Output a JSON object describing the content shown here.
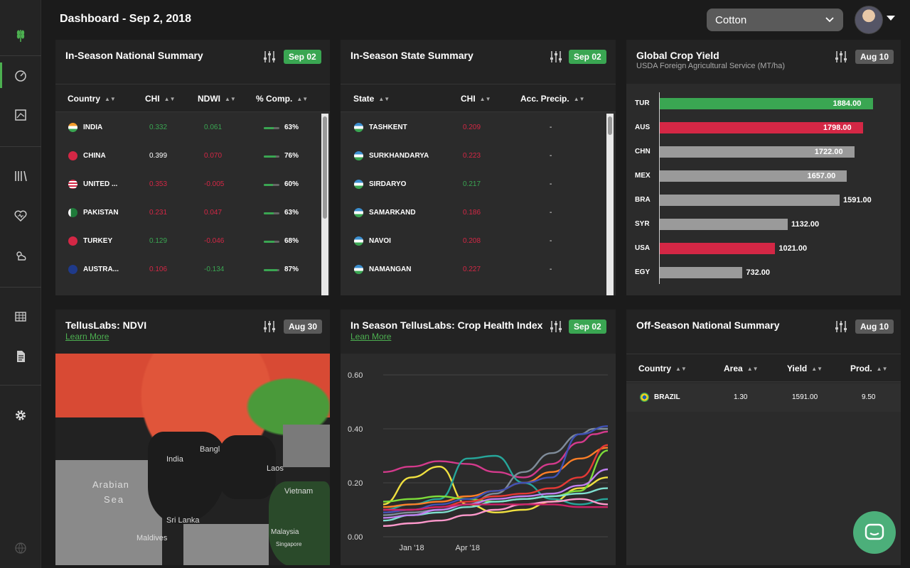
{
  "header": {
    "title": "Dashboard - Sep 2, 2018",
    "crop_selected": "Cotton"
  },
  "colors": {
    "accent": "#3aa652",
    "negative": "#d42745",
    "neutral": "#9a9a9a"
  },
  "panels": {
    "national": {
      "title": "In-Season National Summary",
      "badge": "Sep 02",
      "columns": [
        "Country",
        "CHI",
        "NDWI",
        "% Comp."
      ],
      "rows": [
        {
          "country": "INDIA",
          "chi": "0.332",
          "chi_sign": "pos",
          "ndwi": "0.061",
          "ndwi_sign": "pos",
          "comp": "63%",
          "comp_frac": 0.63
        },
        {
          "country": "CHINA",
          "chi": "0.399",
          "chi_sign": "neutral",
          "ndwi": "0.070",
          "ndwi_sign": "neg",
          "comp": "76%",
          "comp_frac": 0.76
        },
        {
          "country": "UNITED ...",
          "chi": "0.353",
          "chi_sign": "neg",
          "ndwi": "-0.005",
          "ndwi_sign": "neg",
          "comp": "60%",
          "comp_frac": 0.6
        },
        {
          "country": "PAKISTAN",
          "chi": "0.231",
          "chi_sign": "neg",
          "ndwi": "0.047",
          "ndwi_sign": "neg",
          "comp": "63%",
          "comp_frac": 0.63
        },
        {
          "country": "TURKEY",
          "chi": "0.129",
          "chi_sign": "pos",
          "ndwi": "-0.046",
          "ndwi_sign": "neg",
          "comp": "68%",
          "comp_frac": 0.68
        },
        {
          "country": "AUSTRA...",
          "chi": "0.106",
          "chi_sign": "neg",
          "ndwi": "-0.134",
          "ndwi_sign": "pos",
          "comp": "87%",
          "comp_frac": 0.87
        }
      ]
    },
    "state": {
      "title": "In-Season State Summary",
      "badge": "Sep 02",
      "columns": [
        "State",
        "CHI",
        "Acc. Precip."
      ],
      "rows": [
        {
          "state": "TASHKENT",
          "chi": "0.209",
          "chi_sign": "neg",
          "precip": "-"
        },
        {
          "state": "SURKHANDARYA",
          "chi": "0.223",
          "chi_sign": "neg",
          "precip": "-"
        },
        {
          "state": "SIRDARYO",
          "chi": "0.217",
          "chi_sign": "pos",
          "precip": "-"
        },
        {
          "state": "SAMARKAND",
          "chi": "0.186",
          "chi_sign": "neg",
          "precip": "-"
        },
        {
          "state": "NAVOI",
          "chi": "0.208",
          "chi_sign": "neg",
          "precip": "-"
        },
        {
          "state": "NAMANGAN",
          "chi": "0.227",
          "chi_sign": "neg",
          "precip": "-"
        }
      ]
    },
    "yield": {
      "title": "Global Crop Yield",
      "subtitle": "USDA Foreign Agricultural Service (MT/ha)",
      "badge": "Aug 10"
    },
    "ndvi": {
      "title": "TellusLabs: NDVI",
      "learn": "Learn More",
      "badge": "Aug 30",
      "map_labels": [
        "India",
        "Arabian",
        "Sea",
        "Sri Lanka",
        "Maldives",
        "Bangl",
        "Laos",
        "Vietnam",
        "Malaysia",
        "Singapore"
      ]
    },
    "chi": {
      "title": "In Season TellusLabs: Crop Health Index",
      "learn": "Lean More",
      "badge": "Sep 02"
    },
    "offseason": {
      "title": "Off-Season National Summary",
      "badge": "Aug 10",
      "columns": [
        "Country",
        "Area",
        "Yield",
        "Prod."
      ],
      "rows": [
        {
          "country": "BRAZIL",
          "area": "1.30",
          "yield": "1591.00",
          "prod": "9.50"
        }
      ]
    }
  },
  "chart_data": [
    {
      "type": "bar",
      "orientation": "horizontal",
      "title": "Global Crop Yield",
      "subtitle": "USDA Foreign Agricultural Service (MT/ha)",
      "categories": [
        "TUR",
        "AUS",
        "CHN",
        "MEX",
        "BRA",
        "SYR",
        "USA",
        "EGY"
      ],
      "values": [
        1884.0,
        1798.0,
        1722.0,
        1657.0,
        1591.0,
        1132.0,
        1021.0,
        732.0
      ],
      "labels": [
        "1884.00",
        "1798.00",
        "1722.00",
        "1657.00",
        "1591.00",
        "1132.00",
        "1021.00",
        "732.00"
      ],
      "bar_colors": [
        "#3aa652",
        "#d42745",
        "#9a9a9a",
        "#9a9a9a",
        "#9a9a9a",
        "#9a9a9a",
        "#d42745",
        "#9a9a9a"
      ],
      "xlim": [
        0,
        2000
      ],
      "grid": false
    },
    {
      "type": "line",
      "title": "In Season TellusLabs: Crop Health Index",
      "x_ticks": [
        "Jan '18",
        "Apr '18"
      ],
      "y_ticks": [
        "0.00",
        "0.20",
        "0.40",
        "0.60"
      ],
      "ylim": [
        0,
        0.6
      ],
      "x_range_months": [
        0,
        8
      ],
      "grid": true,
      "series": [
        {
          "color": "#d43a8c",
          "x": [
            0,
            1,
            2,
            3,
            4,
            5,
            6,
            7,
            7.5,
            8
          ],
          "y": [
            0.24,
            0.26,
            0.28,
            0.27,
            0.24,
            0.22,
            0.27,
            0.35,
            0.38,
            0.39
          ]
        },
        {
          "color": "#f0e040",
          "x": [
            0,
            1,
            2,
            3,
            4,
            5,
            6,
            7,
            8
          ],
          "y": [
            0.12,
            0.22,
            0.26,
            0.12,
            0.09,
            0.1,
            0.13,
            0.18,
            0.22
          ]
        },
        {
          "color": "#26a69a",
          "x": [
            0,
            1,
            2,
            3,
            4,
            5,
            6,
            7,
            8
          ],
          "y": [
            0.1,
            0.12,
            0.14,
            0.29,
            0.3,
            0.2,
            0.14,
            0.12,
            0.14
          ]
        },
        {
          "color": "#7f8c9a",
          "x": [
            0,
            1,
            2,
            3,
            4,
            5,
            6,
            7,
            7.5,
            8
          ],
          "y": [
            0.08,
            0.09,
            0.1,
            0.12,
            0.16,
            0.24,
            0.31,
            0.38,
            0.4,
            0.4
          ]
        },
        {
          "color": "#ff7f27",
          "x": [
            0,
            1,
            2,
            3,
            4,
            5,
            6,
            7,
            8
          ],
          "y": [
            0.11,
            0.12,
            0.13,
            0.15,
            0.17,
            0.2,
            0.24,
            0.29,
            0.33
          ]
        },
        {
          "color": "#7ddc3a",
          "x": [
            0,
            1,
            2,
            3,
            4,
            5,
            6,
            7,
            8
          ],
          "y": [
            0.13,
            0.14,
            0.15,
            0.14,
            0.13,
            0.14,
            0.15,
            0.17,
            0.32
          ]
        },
        {
          "color": "#e53935",
          "x": [
            0,
            1,
            2,
            3,
            4,
            5,
            6,
            7,
            8
          ],
          "y": [
            0.09,
            0.1,
            0.11,
            0.13,
            0.15,
            0.16,
            0.18,
            0.22,
            0.34
          ]
        },
        {
          "color": "#7fe0d0",
          "x": [
            0,
            1,
            2,
            3,
            4,
            5,
            6,
            7,
            8
          ],
          "y": [
            0.06,
            0.08,
            0.09,
            0.11,
            0.13,
            0.14,
            0.15,
            0.16,
            0.18
          ]
        },
        {
          "color": "#c080f0",
          "x": [
            0,
            1,
            2,
            3,
            4,
            5,
            6,
            7,
            8
          ],
          "y": [
            0.07,
            0.08,
            0.1,
            0.12,
            0.14,
            0.15,
            0.16,
            0.19,
            0.25
          ]
        },
        {
          "color": "#3f51b5",
          "x": [
            0,
            1,
            2,
            3,
            4,
            5,
            6,
            7,
            8
          ],
          "y": [
            0.09,
            0.1,
            0.12,
            0.14,
            0.17,
            0.2,
            0.22,
            0.38,
            0.41
          ]
        },
        {
          "color": "#ff99cc",
          "x": [
            0,
            1,
            2,
            3,
            4,
            5,
            6,
            7,
            8
          ],
          "y": [
            0.04,
            0.05,
            0.06,
            0.08,
            0.1,
            0.12,
            0.13,
            0.14,
            0.12
          ]
        },
        {
          "color": "#cc2266",
          "x": [
            0,
            1,
            2,
            3,
            4,
            5,
            6,
            7,
            8
          ],
          "y": [
            0.1,
            0.1,
            0.11,
            0.12,
            0.12,
            0.12,
            0.12,
            0.11,
            0.11
          ]
        }
      ]
    }
  ]
}
